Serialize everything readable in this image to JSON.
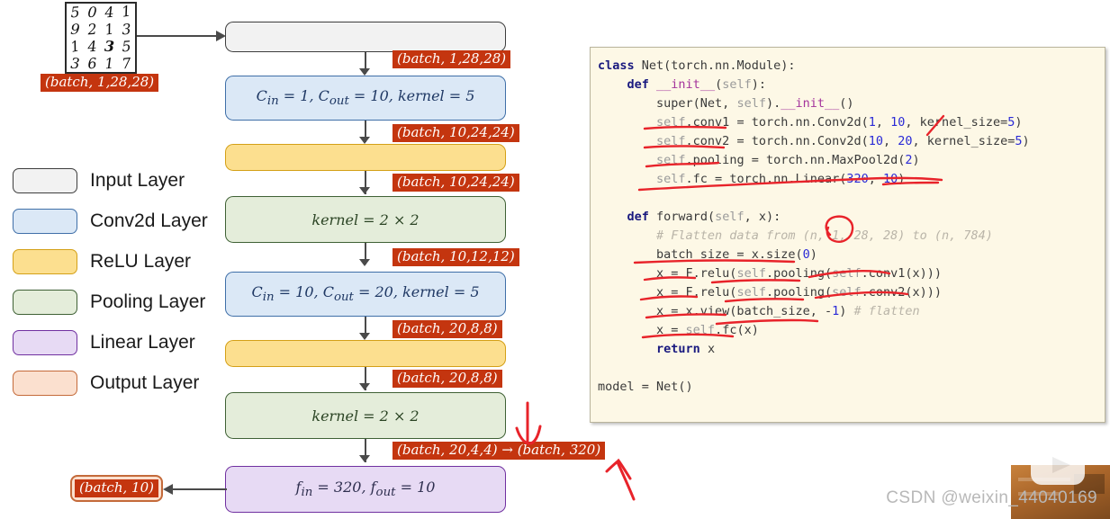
{
  "title": "CNN (MNIST) architecture diagram with PyTorch code",
  "sample_image": {
    "name": "mnist-digit-grid",
    "digits": [
      "5",
      "0",
      "4",
      "1",
      "9",
      "2",
      "1",
      "3",
      "1",
      "4",
      "3",
      "5",
      "3",
      "6",
      "1",
      "7"
    ],
    "shape_tag": "(batch, 1,28,28)"
  },
  "legend": {
    "items": [
      {
        "label": "Input Layer",
        "swatch": "sw-input",
        "color": "#f2f2f2"
      },
      {
        "label": "Conv2d Layer",
        "swatch": "sw-conv",
        "color": "#dbe8f6"
      },
      {
        "label": "ReLU Layer",
        "swatch": "sw-relu",
        "color": "#fcdf8f"
      },
      {
        "label": "Pooling Layer",
        "swatch": "sw-pool",
        "color": "#e4edda"
      },
      {
        "label": "Linear Layer",
        "swatch": "sw-linear",
        "color": "#e7daf4"
      },
      {
        "label": "Output Layer",
        "swatch": "sw-output",
        "color": "#fbe0cf"
      }
    ]
  },
  "flow": {
    "blocks": [
      {
        "kind": "input",
        "label": ""
      },
      {
        "kind": "conv",
        "label": "C_in = 1, C_out = 10, kernel = 5"
      },
      {
        "kind": "relu",
        "label": ""
      },
      {
        "kind": "pool",
        "label": "kernel = 2 × 2"
      },
      {
        "kind": "conv",
        "label": "C_in = 10, C_out = 20, kernel = 5"
      },
      {
        "kind": "relu",
        "label": ""
      },
      {
        "kind": "pool",
        "label": "kernel = 2 × 2"
      },
      {
        "kind": "linear",
        "label": "f_in = 320, f_out = 10"
      }
    ],
    "tags": [
      "(batch, 1,28,28)",
      "(batch, 10,24,24)",
      "(batch, 10,24,24)",
      "(batch, 10,12,12)",
      "(batch, 20,8,8)",
      "(batch, 20,8,8)",
      "(batch, 20,4,4) → (batch, 320)"
    ],
    "output_tag": "(batch, 10)"
  },
  "code": {
    "language": "python",
    "lines": [
      "class Net(torch.nn.Module):",
      "    def __init__(self):",
      "        super(Net, self).__init__()",
      "        self.conv1 = torch.nn.Conv2d(1, 10, kernel_size=5)",
      "        self.conv2 = torch.nn.Conv2d(10, 20, kernel_size=5)",
      "        self.pooling = torch.nn.MaxPool2d(2)",
      "        self.fc = torch.nn.Linear(320, 10)",
      "",
      "    def forward(self, x):",
      "        # Flatten data from (n, 1, 28, 28) to (n, 784)",
      "        batch_size = x.size(0)",
      "        x = F.relu(self.pooling(self.conv1(x)))",
      "        x = F.relu(self.pooling(self.conv2(x)))",
      "        x = x.view(batch_size, -1) # flatten",
      "        x = self.fc(x)",
      "        return x",
      "",
      "model = Net()"
    ]
  },
  "annotations": {
    "color": "#e8232a",
    "notes": [
      "underline-conv1",
      "underline-conv2",
      "underline-pooling",
      "underline-fc-linear",
      "circle-n-in-comment",
      "underline-batch-size",
      "underline-relu-pooling-conv1",
      "underline-relu-pooling-conv2",
      "underline-view-flatten",
      "underline-self-fc",
      "arrow-down-to-flatten-tag",
      "arrow-up-to-320"
    ]
  },
  "watermark": {
    "text": "CSDN @weixin_44040169",
    "logo": "tv-play-icon"
  }
}
